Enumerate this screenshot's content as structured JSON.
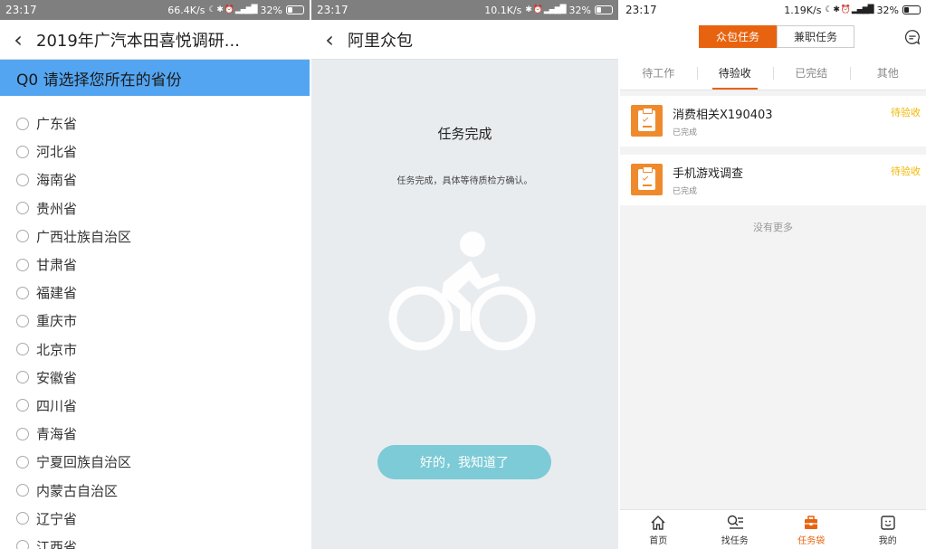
{
  "panel1": {
    "status": {
      "time": "23:17",
      "speed": "66.4K/s",
      "battery": "32%"
    },
    "nav": {
      "title": "2019年广汽本田喜悦调研..."
    },
    "question": "Q0 请选择您所在的省份",
    "options": [
      "广东省",
      "河北省",
      "海南省",
      "贵州省",
      "广西壮族自治区",
      "甘肃省",
      "福建省",
      "重庆市",
      "北京市",
      "安徽省",
      "四川省",
      "青海省",
      "宁夏回族自治区",
      "内蒙古自治区",
      "辽宁省",
      "江西省"
    ]
  },
  "panel2": {
    "status": {
      "time": "23:17",
      "speed": "10.1K/s",
      "battery": "32%"
    },
    "nav": {
      "title": "阿里众包"
    },
    "done_title": "任务完成",
    "done_desc": "任务完成，具体等待质检方确认。",
    "ok_button": "好的，我知道了",
    "illustration_icon": "cyclist-icon"
  },
  "panel3": {
    "status": {
      "time": "23:17",
      "speed": "1.19K/s",
      "battery": "32%"
    },
    "segment": {
      "left": "众包任务",
      "right": "兼职任务"
    },
    "tabs": [
      "待工作",
      "待验收",
      "已完结",
      "其他"
    ],
    "active_tab": "待验收",
    "tasks": [
      {
        "name": "消费相关X190403",
        "sub": "已完成",
        "state": "待验收"
      },
      {
        "name": "手机游戏调查",
        "sub": "已完成",
        "state": "待验收"
      }
    ],
    "no_more": "没有更多",
    "bottom_nav": [
      {
        "label": "首页",
        "icon": "home-icon"
      },
      {
        "label": "找任务",
        "icon": "find-task-icon"
      },
      {
        "label": "任务袋",
        "icon": "task-bag-icon"
      },
      {
        "label": "我的",
        "icon": "profile-icon"
      }
    ],
    "accent": "#e8630f",
    "pending_color": "#f0b800"
  },
  "colors": {
    "question_bar": "#53a5f1",
    "ok_button": "#7ccbd6",
    "panel2_bg": "#e9ecef"
  }
}
